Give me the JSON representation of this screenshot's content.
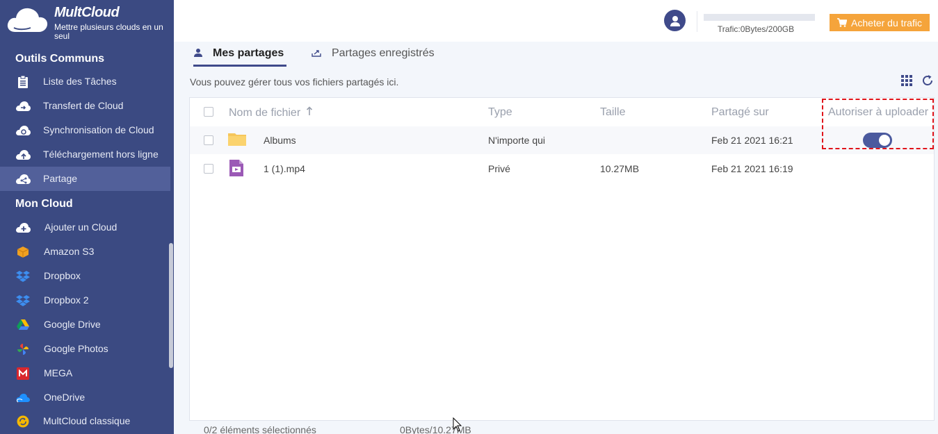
{
  "app": {
    "brand": "MultCloud",
    "tagline": "Mettre plusieurs clouds en un seul"
  },
  "sidebar": {
    "section_tools": "Outils Communs",
    "tools": [
      {
        "label": "Liste des Tâches",
        "icon": "clipboard-icon"
      },
      {
        "label": "Transfert de Cloud",
        "icon": "cloud-transfer-icon"
      },
      {
        "label": "Synchronisation de Cloud",
        "icon": "cloud-sync-icon"
      },
      {
        "label": "Téléchargement hors ligne",
        "icon": "cloud-upload-icon"
      },
      {
        "label": "Partage",
        "icon": "cloud-share-icon",
        "active": true
      }
    ],
    "section_clouds": "Mon Cloud",
    "clouds": [
      {
        "label": "Ajouter un Cloud",
        "icon": "add-cloud-icon"
      },
      {
        "label": "Amazon S3",
        "icon": "amazon-s3-icon"
      },
      {
        "label": "Dropbox",
        "icon": "dropbox-icon"
      },
      {
        "label": "Dropbox 2",
        "icon": "dropbox-icon"
      },
      {
        "label": "Google Drive",
        "icon": "google-drive-icon"
      },
      {
        "label": "Google Photos",
        "icon": "google-photos-icon"
      },
      {
        "label": "MEGA",
        "icon": "mega-icon"
      },
      {
        "label": "OneDrive",
        "icon": "onedrive-icon"
      },
      {
        "label": "MultCloud classique",
        "icon": "multcloud-classic-icon"
      }
    ]
  },
  "header": {
    "traffic": "Trafic:0Bytes/200GB",
    "traffic_used_fraction": 0,
    "buy_label": "Acheter du trafic"
  },
  "tabs": {
    "mine": "Mes partages",
    "saved": "Partages enregistrés"
  },
  "description": "Vous pouvez gérer tous vos fichiers partagés ici.",
  "table": {
    "columns": {
      "name": "Nom de fichier",
      "type": "Type",
      "size": "Taille",
      "shared_on": "Partagé sur",
      "allow_upload": "Autoriser à uploader"
    },
    "rows": [
      {
        "name": "Albums",
        "icon": "folder-icon",
        "type": "N'importe qui",
        "size": "",
        "shared_on": "Feb 21 2021 16:21",
        "allow_upload": true
      },
      {
        "name": "1 (1).mp4",
        "icon": "video-file-icon",
        "type": "Privé",
        "size": "10.27MB",
        "shared_on": "Feb 21 2021 16:19",
        "allow_upload": null
      }
    ]
  },
  "footer": {
    "selected": "0/2 éléments sélectionnés",
    "size": "0Bytes/10.27MB"
  },
  "colors": {
    "sidebar": "#3b4a82",
    "accent": "#3f4a8a",
    "buy_button": "#f5a43b",
    "highlight_box": "#e0141b"
  }
}
